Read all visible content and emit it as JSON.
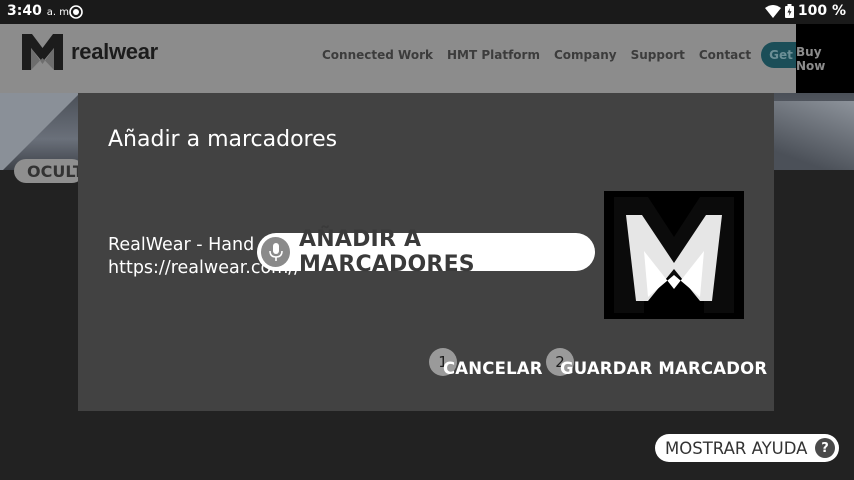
{
  "status_bar": {
    "time": "3:40",
    "ampm": "a. m.",
    "battery": "100 %"
  },
  "site": {
    "logo_text": "realwear",
    "nav": [
      "Connected Work",
      "HMT Platform",
      "Company",
      "Support",
      "Contact"
    ],
    "demo_label": "Get Demo",
    "buy_label": "Buy Now",
    "hide_label": "OCULTAR"
  },
  "dialog": {
    "title": "Añadir a marcadores",
    "bookmark_title": "RealWear - Hand",
    "bookmark_url": "https://realwear.com//",
    "cancel": {
      "number": "1",
      "label": "CANCELAR"
    },
    "save": {
      "number": "2",
      "label": "GUARDAR MARCADOR"
    }
  },
  "voice_command": {
    "text": "AÑADIR A MARCADORES"
  },
  "help": {
    "label": "MOSTRAR AYUDA",
    "q": "?"
  },
  "colors": {
    "dialog_bg": "#424242",
    "status_bar": "#1a1a1a",
    "demo_button": "#1b4e58"
  }
}
